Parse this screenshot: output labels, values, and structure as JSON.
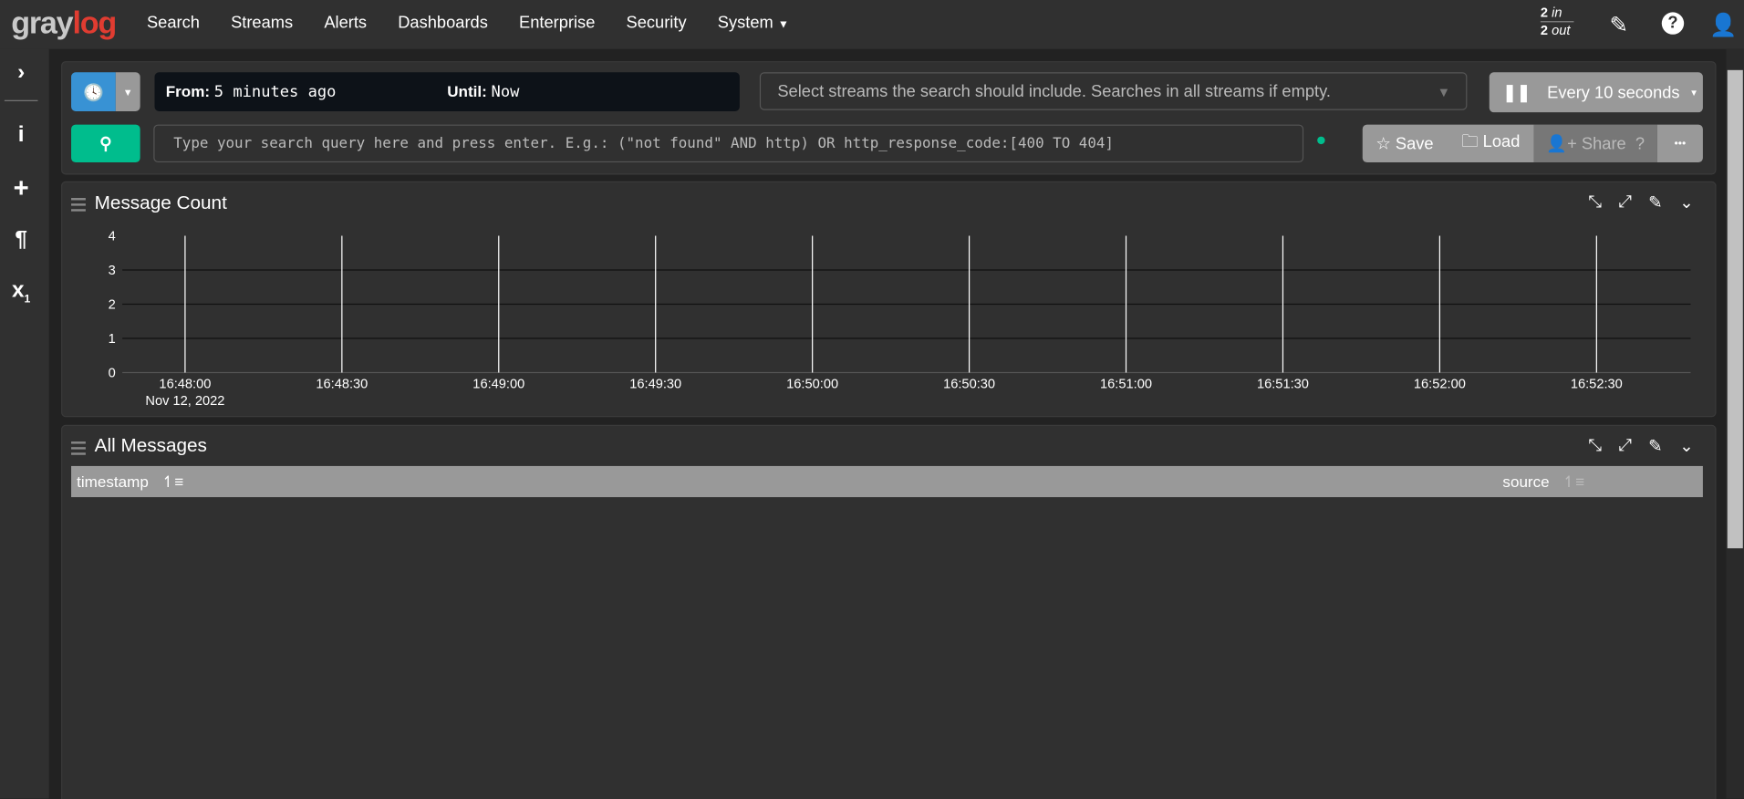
{
  "nav": {
    "logo": "graylog",
    "items": [
      "Search",
      "Streams",
      "Alerts",
      "Dashboards",
      "Enterprise",
      "Security",
      "System"
    ],
    "throughput": {
      "in_count": "2",
      "in_label": "in",
      "out_count": "2",
      "out_label": "out"
    }
  },
  "search": {
    "from_label": "From:",
    "from_value": "5 minutes ago",
    "until_label": "Until:",
    "until_value": "Now",
    "streams_placeholder": "Select streams the search should include. Searches in all streams if empty.",
    "refresh_label": "Every 10 seconds",
    "query_placeholder": "Type your search query here and press enter. E.g.: (\"not found\" AND http) OR http_response_code:[400 TO 404]",
    "save_label": "Save",
    "load_label": "Load",
    "share_label": "Share",
    "more_label": "•••"
  },
  "colors": {
    "accent_blue": "#3892d4",
    "accent_green": "#00bd8d",
    "logo_red": "#e03c31"
  },
  "widgets": {
    "message_count": {
      "title": "Message Count"
    },
    "all_messages": {
      "title": "All Messages",
      "columns": [
        "timestamp",
        "source"
      ]
    }
  },
  "chart_data": {
    "type": "bar",
    "title": "Message Count",
    "xlabel": "",
    "ylabel": "",
    "x_range": [
      "16:47:48",
      "16:52:48"
    ],
    "x_ticks": [
      "16:48:00",
      "16:48:30",
      "16:49:00",
      "16:49:30",
      "16:50:00",
      "16:50:30",
      "16:51:00",
      "16:51:30",
      "16:52:00",
      "16:52:30"
    ],
    "x_date_label": "Nov 12, 2022",
    "y_ticks": [
      0,
      1,
      2,
      3,
      4
    ],
    "ylim": [
      0,
      4
    ],
    "values": [],
    "grid": true
  }
}
